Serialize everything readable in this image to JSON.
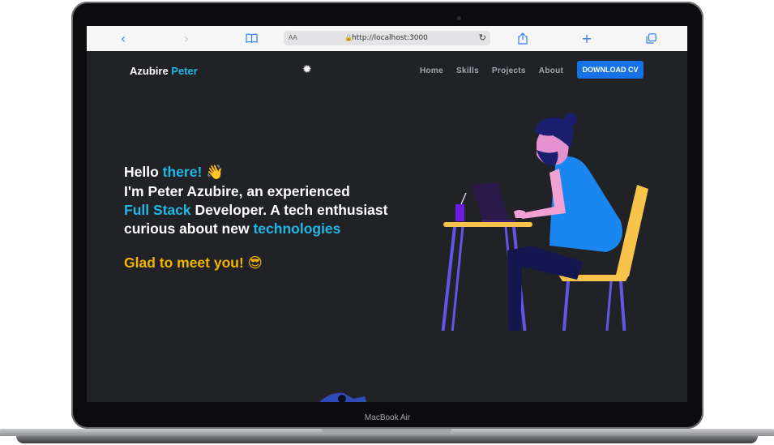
{
  "device": {
    "label": "MacBook Air"
  },
  "browser": {
    "url": "http://localhost:3000",
    "text_size_label": "AA",
    "icons": {
      "back": "chevron-left-icon",
      "forward": "chevron-right-icon",
      "bookmarks": "book-icon",
      "lock": "lock-icon",
      "reload": "reload-icon",
      "share": "share-icon",
      "new_tab": "plus-icon",
      "tabs": "tabs-icon"
    }
  },
  "header": {
    "brand_first": "Azubire",
    "brand_last": "Peter",
    "theme_icon": "sun-icon",
    "nav": [
      "Home",
      "Skills",
      "Projects",
      "About"
    ],
    "cta": "DOWNLOAD CV"
  },
  "hero": {
    "l1_a": "Hello ",
    "l1_b": "there!",
    "l1_emoji": "👋",
    "l2": "I'm Peter Azubire, an experienced",
    "l3_a": "Full Stack",
    "l3_b": " Developer. A tech enthusiast",
    "l4_a": "curious about new ",
    "l4_b": "technologies",
    "greeting": "Glad to meet you!",
    "greeting_emoji": "😎"
  },
  "colors": {
    "accent": "#21b7e4",
    "cta": "#1672e6",
    "greeting": "#f5b400",
    "background": "#202226"
  }
}
